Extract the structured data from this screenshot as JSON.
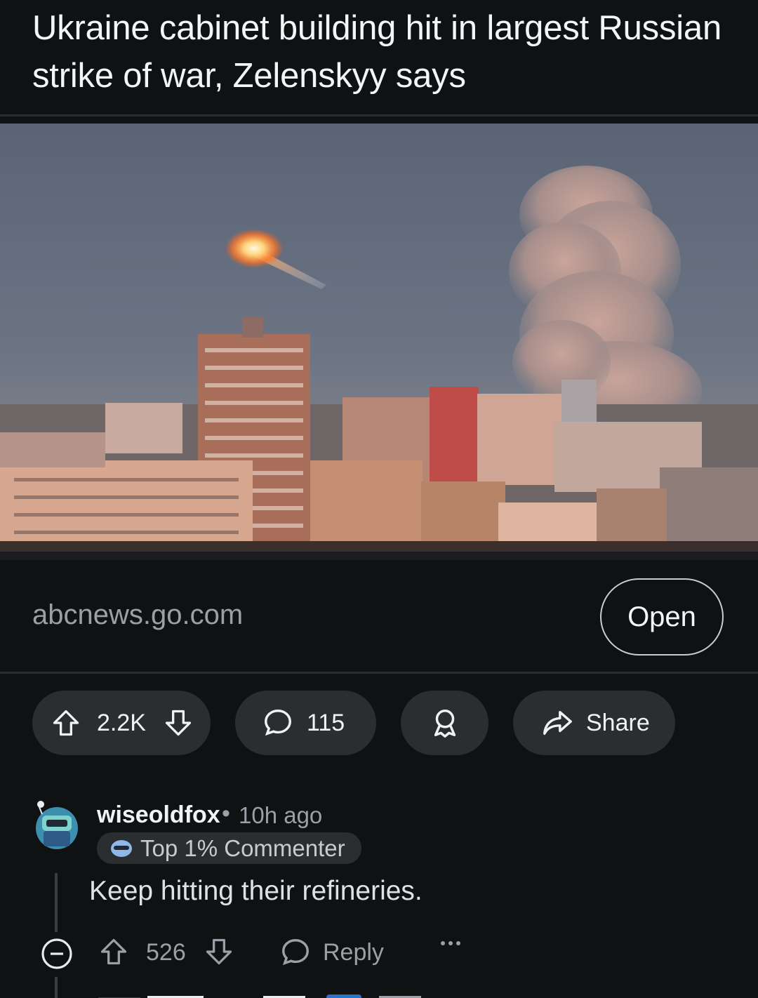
{
  "post": {
    "title": "Ukraine cabinet building hit in largest Russian strike of war, Zelenskyy says",
    "link_domain": "abcnews.go.com",
    "open_label": "Open"
  },
  "actions": {
    "upvotes": "2.2K",
    "comments": "115",
    "share_label": "Share"
  },
  "comment": {
    "username": "wiseoldfox",
    "separator": "•",
    "time": "10h ago",
    "badge": "Top 1% Commenter",
    "body": "Keep hitting their refineries.",
    "score": "526",
    "reply_label": "Reply"
  },
  "colors": {
    "background": "#0f1113",
    "pill": "#2b2e31",
    "muted_text": "#9aa0a6"
  },
  "icons": [
    "upvote-icon",
    "downvote-icon",
    "comment-icon",
    "award-icon",
    "share-icon",
    "collapse-icon",
    "reply-icon",
    "more-icon"
  ]
}
